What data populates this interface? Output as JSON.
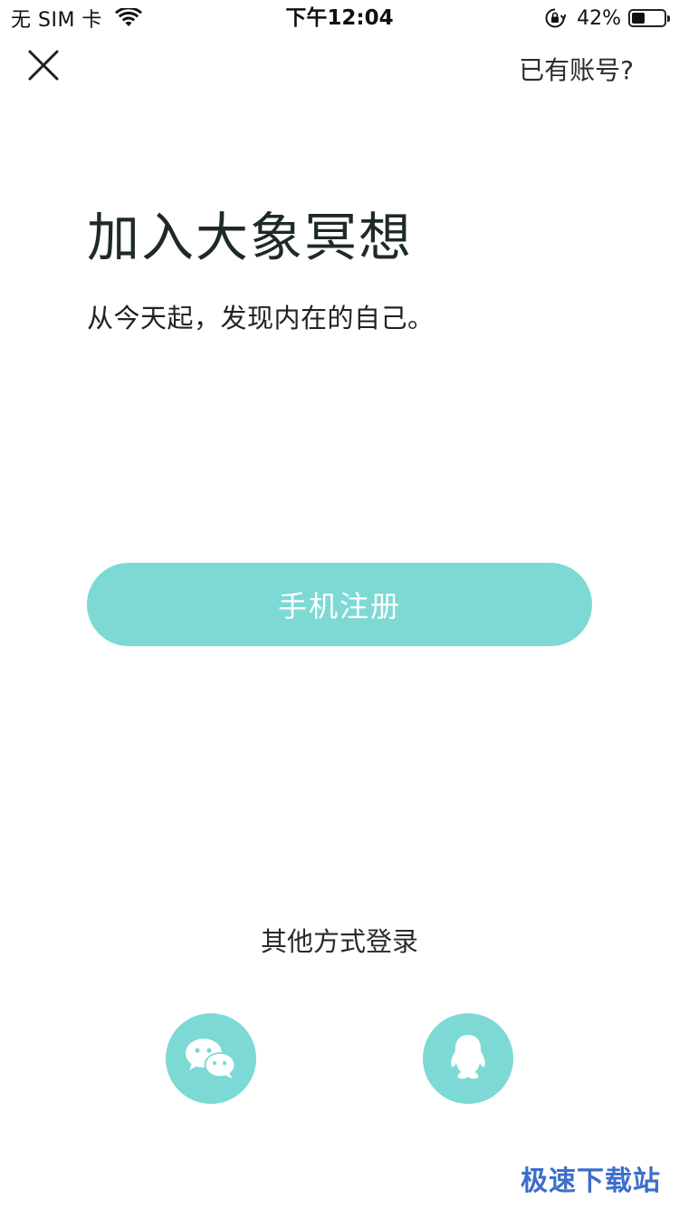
{
  "status_bar": {
    "carrier": "无 SIM 卡",
    "time": "下午12:04",
    "battery_percent_label": "42%",
    "battery_level": 0.42,
    "icons": [
      "wifi-icon",
      "orientation-lock-icon",
      "battery-icon"
    ]
  },
  "nav": {
    "close_icon": "close-icon",
    "have_account": "已有账号?"
  },
  "hero": {
    "title": "加入大象冥想",
    "subtitle": "从今天起，发现内在的自己。"
  },
  "register": {
    "label": "手机注册"
  },
  "other_login": {
    "label": "其他方式登录",
    "providers": [
      {
        "icon": "wechat-icon"
      },
      {
        "icon": "qq-icon"
      }
    ]
  },
  "watermark": {
    "text": "极速下载站"
  },
  "colors": {
    "accent": "#7dd9d4",
    "text": "#1f1f1f",
    "watermark": "#3d6ec9"
  }
}
